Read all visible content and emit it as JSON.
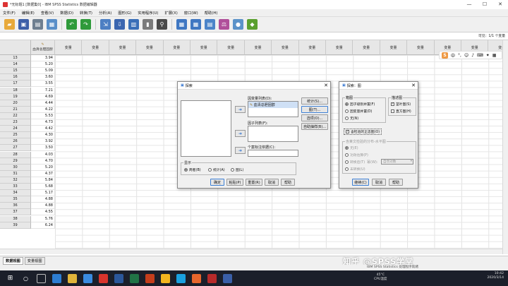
{
  "window": {
    "title": "*无标题1 [数据集0] - IBM SPSS Statistics 数据编辑器",
    "min": "—",
    "max": "☐",
    "close": "✕"
  },
  "menu": [
    "文件(F)",
    "编辑(E)",
    "查看(V)",
    "数据(D)",
    "转换(T)",
    "分析(A)",
    "图形(G)",
    "实用程序(U)",
    "扩展(X)",
    "窗口(W)",
    "帮助(H)"
  ],
  "toolbar_icons": [
    "open-icon",
    "save-icon",
    "print-icon",
    "dialog-recall-icon",
    "undo-icon",
    "redo-icon",
    "goto-case-icon",
    "goto-variable-icon",
    "variables-icon",
    "run-descriptives-icon",
    "find-icon",
    "insert-cases-icon",
    "insert-variable-icon",
    "split-file-icon",
    "weight-cases-icon",
    "select-cases-icon",
    "value-labels-icon",
    "use-sets-icon",
    "show-all-icon"
  ],
  "visible_label": "可见：1/1 个变量",
  "grid": {
    "first_col_header": "血清总胆固醇",
    "empty_col_header": "变量",
    "rows": [
      {
        "n": "13",
        "v": "3.94"
      },
      {
        "n": "14",
        "v": "5.20"
      },
      {
        "n": "15",
        "v": "5.09"
      },
      {
        "n": "16",
        "v": "3.60"
      },
      {
        "n": "17",
        "v": "3.55"
      },
      {
        "n": "18",
        "v": "7.21"
      },
      {
        "n": "19",
        "v": "4.69"
      },
      {
        "n": "20",
        "v": "4.44"
      },
      {
        "n": "21",
        "v": "4.22"
      },
      {
        "n": "22",
        "v": "5.53"
      },
      {
        "n": "23",
        "v": "4.73"
      },
      {
        "n": "24",
        "v": "4.42"
      },
      {
        "n": "25",
        "v": "4.30"
      },
      {
        "n": "26",
        "v": "3.92"
      },
      {
        "n": "27",
        "v": "3.50"
      },
      {
        "n": "28",
        "v": "4.03"
      },
      {
        "n": "29",
        "v": "4.70"
      },
      {
        "n": "30",
        "v": "5.20"
      },
      {
        "n": "31",
        "v": "4.37"
      },
      {
        "n": "32",
        "v": "5.84"
      },
      {
        "n": "33",
        "v": "5.68"
      },
      {
        "n": "34",
        "v": "5.17"
      },
      {
        "n": "35",
        "v": "4.88"
      },
      {
        "n": "36",
        "v": "4.88"
      },
      {
        "n": "37",
        "v": "4.55"
      },
      {
        "n": "38",
        "v": "5.76"
      },
      {
        "n": "39",
        "v": "6.24"
      }
    ]
  },
  "ime": {
    "logo": "S",
    "label": "中"
  },
  "explore": {
    "title": "探索",
    "dependent_label": "因变量列表(D):",
    "dependent_item": "血清总胆固醇",
    "factor_label": "因子列表(F):",
    "case_label": "个案标注依据(C):",
    "side_buttons": [
      "统计(S)...",
      "图(T)...",
      "选项(O)...",
      "自助抽样(B)..."
    ],
    "display_title": "显示",
    "display_options": [
      "两者(B)",
      "统计(A)",
      "图(L)"
    ],
    "bottom_buttons": [
      "确定",
      "粘贴(P)",
      "重置(R)",
      "取消",
      "帮助"
    ]
  },
  "plots": {
    "title": "探索：图",
    "boxplot_title": "箱图",
    "boxplot_options": [
      "因子级别并置(F)",
      "因变量并置(D)",
      "无(N)"
    ],
    "desc_title": "描述图",
    "desc_options": [
      "茎叶图(S)",
      "直方图(H)"
    ],
    "normality": "含检验的正态图(O)",
    "spread_title": "含莱文检验的分布-水平图",
    "spread_options": [
      "无(E)",
      "功效估算(P)",
      "转换后(T)",
      "未转换(U)"
    ],
    "power_label": "幂(W):",
    "power_value": "自然对数",
    "buttons": [
      "继续(C)",
      "取消",
      "帮助"
    ]
  },
  "sheets": [
    "数据视图",
    "变量视图"
  ],
  "status": "IBM SPSS Statistics 处理程序就绪",
  "watermark": "知乎 @SPSS学堂",
  "tray": {
    "temp": "45°C",
    "cpu": "CPU温度",
    "time": "10:42",
    "date": "2020/3/14"
  },
  "colors": {
    "accent": "#2a6fcf",
    "taskbar": "#1b1f2a"
  }
}
